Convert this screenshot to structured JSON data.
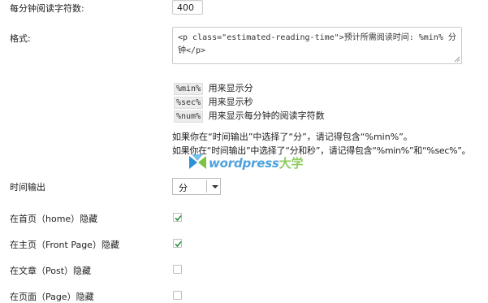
{
  "fields": {
    "words_per_minute": {
      "label": "每分钟阅读字符数:",
      "value": "400"
    },
    "format": {
      "label": "格式:",
      "value": "<p class=\"estimated-reading-time\">预计所需阅读时间: %min% 分钟</p>"
    },
    "placeholders": [
      {
        "code": "%min%",
        "desc": "用来显示分"
      },
      {
        "code": "%sec%",
        "desc": "用来显示秒"
      },
      {
        "code": "%num%",
        "desc": "用来显示每分钟的阅读字符数"
      }
    ],
    "notes": [
      "如果你在“时间输出”中选择了“分”，请记得包含“%min%”。",
      "如果你在“时间输出”中选择了“分和秒”，请记得包含“%min%”和“%sec%”。"
    ],
    "time_output": {
      "label": "时间输出",
      "selected": "分"
    },
    "hide_options": [
      {
        "label": "在首页（home）隐藏",
        "checked": true
      },
      {
        "label": "在主页（Front Page）隐藏",
        "checked": true
      },
      {
        "label": "在文章（Post）隐藏",
        "checked": false
      },
      {
        "label": "在页面（Page）隐藏",
        "checked": false
      }
    ]
  },
  "watermark": {
    "brand": "wordpress",
    "suffix": "大学"
  },
  "colors": {
    "check": "#2a8f3c",
    "watermark_blue": "#2d91d6",
    "watermark_green": "#7cc243"
  }
}
